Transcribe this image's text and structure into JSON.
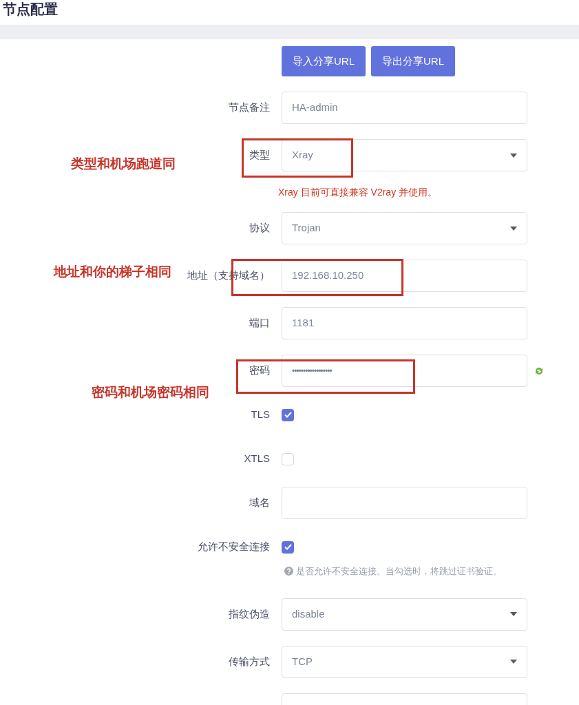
{
  "title": "节点配置",
  "buttons": [
    "导入分享URL",
    "导出分享URL"
  ],
  "rows": [
    {
      "kind": "text",
      "label": "节点备注",
      "value": "HA-admin"
    },
    {
      "kind": "select",
      "label": "类型",
      "value": "Xray"
    },
    {
      "kind": "warning",
      "text": "Xray 目前可直接兼容 V2ray 并使用。"
    },
    {
      "kind": "select",
      "label": "协议",
      "value": "Trojan"
    },
    {
      "kind": "text",
      "label": "地址（支持域名）",
      "value": "192.168.10.250"
    },
    {
      "kind": "text",
      "label": "端口",
      "value": "1181"
    },
    {
      "kind": "password",
      "label": "密码",
      "value": "••••••••••••••••••"
    },
    {
      "kind": "checkbox",
      "label": "TLS",
      "checked": true
    },
    {
      "kind": "checkbox",
      "label": "XTLS",
      "checked": false
    },
    {
      "kind": "text",
      "label": "域名"
    },
    {
      "kind": "checkbox",
      "label": "允许不安全连接",
      "checked": true
    },
    {
      "kind": "help",
      "text": "是否允许不安全连接。当勾选时，将跳过证书验证。"
    },
    {
      "kind": "select",
      "label": "指纹伪造",
      "value": "disable"
    },
    {
      "kind": "select",
      "label": "传输方式",
      "value": "TCP"
    },
    {
      "kind": "text"
    }
  ],
  "annotations": [
    "类型和机场跑道同",
    "地址和你的梯子相同",
    "密码和机场密码相同"
  ]
}
